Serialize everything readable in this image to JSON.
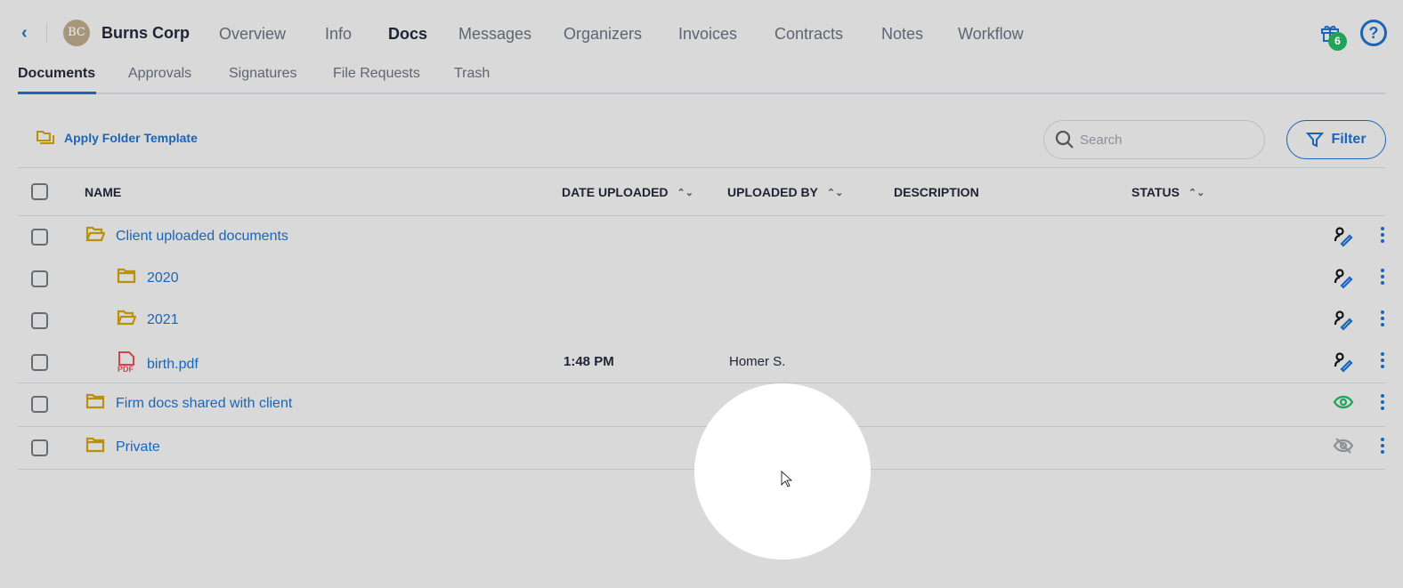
{
  "header": {
    "client_initials": "BC",
    "client_name": "Burns Corp",
    "tabs": [
      "Overview",
      "Info",
      "Docs",
      "Messages",
      "Organizers",
      "Invoices",
      "Contracts",
      "Notes",
      "Workflow"
    ],
    "active_tab": "Docs",
    "gift_badge": "6"
  },
  "subtabs": [
    "Documents",
    "Approvals",
    "Signatures",
    "File Requests",
    "Trash"
  ],
  "toolbar": {
    "apply_label": "Apply Folder Template",
    "search_placeholder": "Search",
    "filter_label": "Filter"
  },
  "columns": {
    "name": "NAME",
    "date": "DATE UPLOADED",
    "by": "UPLOADED BY",
    "desc": "DESCRIPTION",
    "status": "STATUS"
  },
  "rows": [
    {
      "name": "Client uploaded documents",
      "type": "folder-open",
      "date": "",
      "by": "",
      "status": "client-edit"
    },
    {
      "name": "2020",
      "type": "folder",
      "date": "",
      "by": "",
      "status": "client-edit"
    },
    {
      "name": "2021",
      "type": "folder-open",
      "date": "",
      "by": "",
      "status": "client-edit"
    },
    {
      "name": "birth.pdf",
      "type": "pdf",
      "date": "1:48 PM",
      "by": "Homer S.",
      "status": "client-edit"
    },
    {
      "name": "Firm docs shared with client",
      "type": "folder",
      "date": "",
      "by": "",
      "status": "visible"
    },
    {
      "name": "Private",
      "type": "folder",
      "date": "",
      "by": "",
      "status": "hidden"
    }
  ],
  "colors": {
    "accent": "#1b65b8",
    "folder": "#b8900a",
    "green": "#22a35a"
  }
}
